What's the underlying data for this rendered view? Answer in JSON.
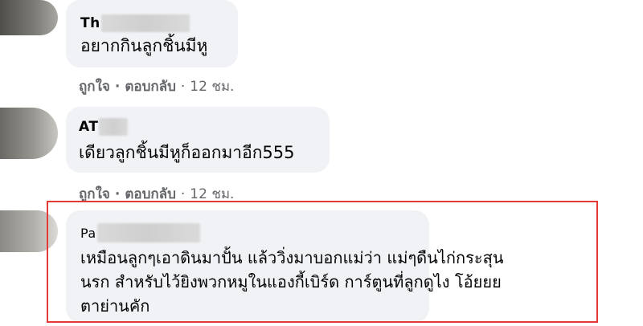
{
  "comments": [
    {
      "name_visible": "Th",
      "text": "อยากกินลูกชิ้นมีหู",
      "actions": {
        "like": "ถูกใจ",
        "reply": "ตอบกลับ",
        "time": "12 ชม."
      }
    },
    {
      "name_visible": "AT",
      "text": "เดียวลูกชิ้นมีหูก็ออกมาอีก555",
      "actions": {
        "like": "ถูกใจ",
        "reply": "ตอบกลับ",
        "time": "12 ชม."
      }
    },
    {
      "name_visible": "Pa",
      "text_lines": [
        "เหมือนลูกๆเอาดินมาปั้น แล้ววิ่งมาบอกแม่ว่า แม่ๆดืนไก่กระสุน",
        "นรก สำหรับไว้ยิงพวกหมูในแองกี้เบิร์ด การ์ตูนที่ลูกดูไง โอ้ยยย",
        "ตาย่านคัก"
      ]
    }
  ],
  "separator": "·",
  "highlight_color": "#e53935",
  "bubble_color": "#f0f2f5",
  "action_color": "#65676b"
}
